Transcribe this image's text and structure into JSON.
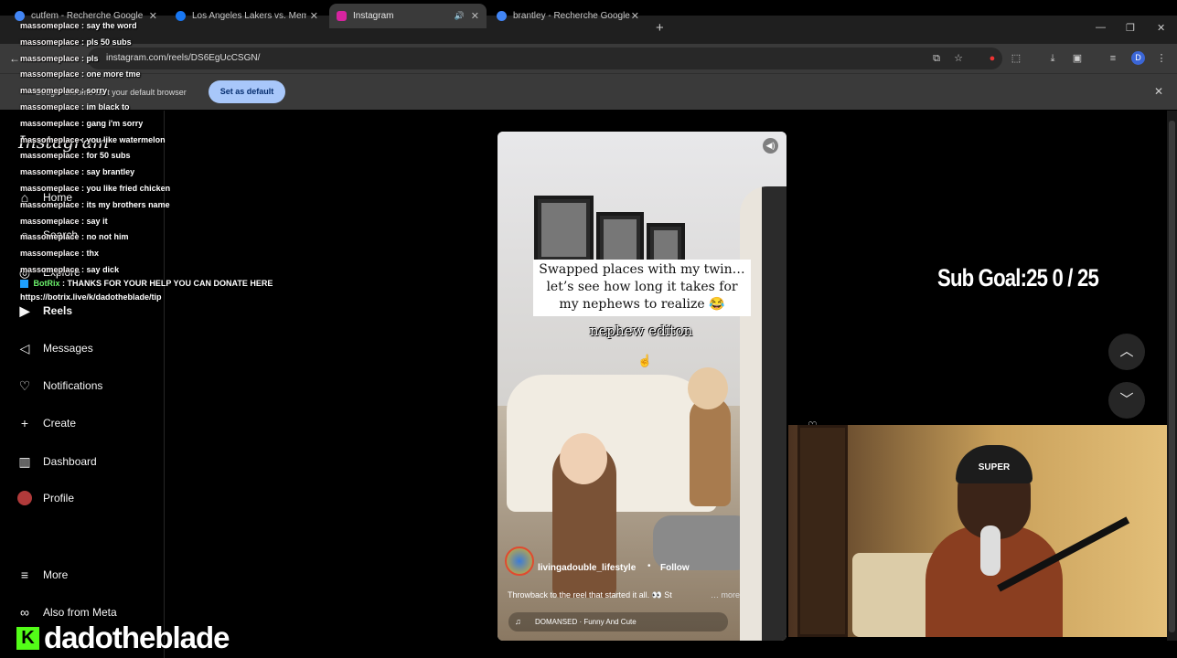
{
  "browser": {
    "tabs": [
      {
        "title": "cutfem - Recherche Google",
        "favicon_color": "#4285f4"
      },
      {
        "title": "Los Angeles Lakers vs. Memphis",
        "favicon_color": "#1877f2"
      },
      {
        "title": "Instagram",
        "favicon_color": "#d6249f"
      },
      {
        "title": "brantley - Recherche Google",
        "favicon_color": "#4285f4"
      }
    ],
    "url": "instagram.com/reels/DS6EgUcCSGN/",
    "profile_initial": "D",
    "infobar": {
      "text": "Google Chrome isn't your default browser",
      "button": "Set as default"
    }
  },
  "instagram": {
    "logo": "Instagram",
    "nav": [
      {
        "label": "Home",
        "icon": "home-icon"
      },
      {
        "label": "Search",
        "icon": "search-icon"
      },
      {
        "label": "Explore",
        "icon": "compass-icon"
      },
      {
        "label": "Reels",
        "icon": "reels-icon"
      },
      {
        "label": "Messages",
        "icon": "messages-icon"
      },
      {
        "label": "Notifications",
        "icon": "heart-icon"
      },
      {
        "label": "Create",
        "icon": "plus-icon"
      },
      {
        "label": "Dashboard",
        "icon": "dashboard-icon"
      },
      {
        "label": "Profile",
        "icon": "avatar"
      },
      {
        "label": "More",
        "icon": "menu-icon"
      },
      {
        "label": "Also from Meta",
        "icon": "meta-icon"
      }
    ],
    "reel": {
      "caption_lines": [
        "Swapped places with my twin…",
        "let’s see how long it takes for",
        "my nephews to realize 😂"
      ],
      "overlay_label": "nephew editon",
      "username": "livingadouble_lifestyle",
      "follow": "Follow",
      "dot": "•",
      "description": "Throwback to the reel that started it all. 👀 St",
      "more": "… more",
      "audio": "DOMANSED · Funny And Cute"
    }
  },
  "stream": {
    "sub_goal": "Sub Goal:25   0 / 25",
    "streamer": "dadotheblade",
    "webcam_beanie": "SUPER",
    "chat": [
      {
        "user": "massomeplace",
        "msg": "say the word"
      },
      {
        "user": "massomeplace",
        "msg": "pls 50 subs"
      },
      {
        "user": "massomeplace",
        "msg": "pls"
      },
      {
        "user": "massomeplace",
        "msg": "one more tme"
      },
      {
        "user": "massomeplace",
        "msg": "sorry"
      },
      {
        "user": "massomeplace",
        "msg": "im black to"
      },
      {
        "user": "massomeplace",
        "msg": "gang i'm sorry"
      },
      {
        "user": "massomeplace",
        "msg": "you like watermelon"
      },
      {
        "user": "massomeplace",
        "msg": "for 50 subs"
      },
      {
        "user": "massomeplace",
        "msg": "say brantley"
      },
      {
        "user": "massomeplace",
        "msg": "you like fried chicken"
      },
      {
        "user": "massomeplace",
        "msg": "its my brothers name"
      },
      {
        "user": "massomeplace",
        "msg": "say it"
      },
      {
        "user": "massomeplace",
        "msg": "no not him"
      },
      {
        "user": "massomeplace",
        "msg": "thx"
      },
      {
        "user": "massomeplace",
        "msg": "say dick"
      }
    ],
    "bot": {
      "name": "BotRix",
      "msg": ": THANKS FOR YOUR HELP YOU CAN DONATE HERE",
      "url": "https://botrix.live/k/dadotheblade/tip"
    }
  }
}
